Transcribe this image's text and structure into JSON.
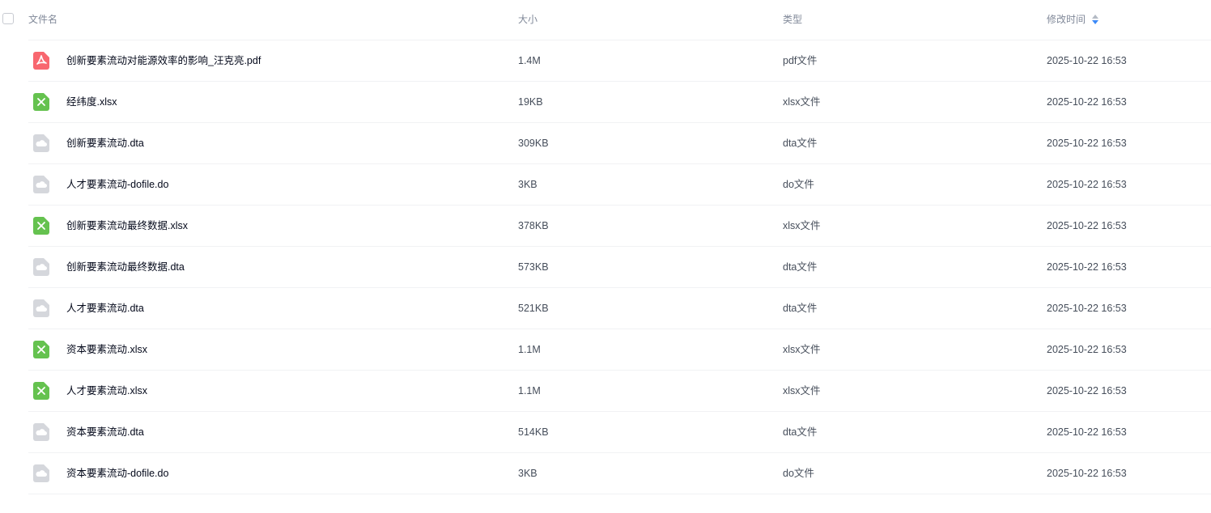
{
  "columns": {
    "name": "文件名",
    "size": "大小",
    "type": "类型",
    "modified": "修改时间"
  },
  "sort_icon": "sort-icon",
  "files": [
    {
      "icon": "pdf-file-icon",
      "name": "创新要素流动对能源效率的影响_汪克亮.pdf",
      "size": "1.4M",
      "type": "pdf文件",
      "modified": "2025-10-22 16:53"
    },
    {
      "icon": "excel-file-icon",
      "name": "经纬度.xlsx",
      "size": "19KB",
      "type": "xlsx文件",
      "modified": "2025-10-22 16:53"
    },
    {
      "icon": "generic-file-icon",
      "name": "创新要素流动.dta",
      "size": "309KB",
      "type": "dta文件",
      "modified": "2025-10-22 16:53"
    },
    {
      "icon": "generic-file-icon",
      "name": "人才要素流动-dofile.do",
      "size": "3KB",
      "type": "do文件",
      "modified": "2025-10-22 16:53"
    },
    {
      "icon": "excel-file-icon",
      "name": "创新要素流动最终数据.xlsx",
      "size": "378KB",
      "type": "xlsx文件",
      "modified": "2025-10-22 16:53"
    },
    {
      "icon": "generic-file-icon",
      "name": "创新要素流动最终数据.dta",
      "size": "573KB",
      "type": "dta文件",
      "modified": "2025-10-22 16:53"
    },
    {
      "icon": "generic-file-icon",
      "name": "人才要素流动.dta",
      "size": "521KB",
      "type": "dta文件",
      "modified": "2025-10-22 16:53"
    },
    {
      "icon": "excel-file-icon",
      "name": "资本要素流动.xlsx",
      "size": "1.1M",
      "type": "xlsx文件",
      "modified": "2025-10-22 16:53"
    },
    {
      "icon": "excel-file-icon",
      "name": "人才要素流动.xlsx",
      "size": "1.1M",
      "type": "xlsx文件",
      "modified": "2025-10-22 16:53"
    },
    {
      "icon": "generic-file-icon",
      "name": "资本要素流动.dta",
      "size": "514KB",
      "type": "dta文件",
      "modified": "2025-10-22 16:53"
    },
    {
      "icon": "generic-file-icon",
      "name": "资本要素流动-dofile.do",
      "size": "3KB",
      "type": "do文件",
      "modified": "2025-10-22 16:53"
    }
  ],
  "colors": {
    "pdf": "#f8676f",
    "excel": "#65c24f",
    "generic": "#d5d7dc",
    "sort_up": "#b4bac4",
    "sort_down": "#3d8af7"
  }
}
